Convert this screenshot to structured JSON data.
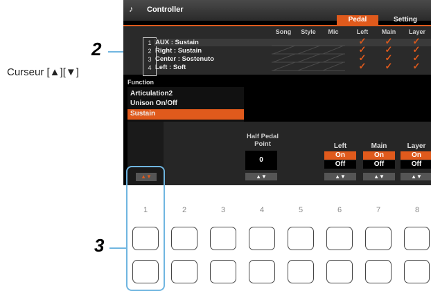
{
  "screen": {
    "title": "Controller",
    "title_icon": "♪",
    "tabs": [
      {
        "label": "Pedal",
        "active": true
      },
      {
        "label": "Setting",
        "active": false
      }
    ],
    "columns": [
      "Song",
      "Style",
      "Mic",
      "Left",
      "Main",
      "Layer"
    ],
    "rows": [
      {
        "num": "1",
        "label": "AUX : Sustain"
      },
      {
        "num": "2",
        "label": "Right : Sustain"
      },
      {
        "num": "3",
        "label": "Center : Sostenuto"
      },
      {
        "num": "4",
        "label": "Left : Soft"
      }
    ],
    "check_glyph": "✓",
    "function_label": "Function",
    "function_items": [
      "Articulation2",
      "Unison On/Off",
      "Sustain"
    ],
    "half_pedal_label_1": "Half Pedal",
    "half_pedal_label_2": "Point",
    "half_pedal_value": "0",
    "switches": [
      {
        "label": "Left",
        "on": "On",
        "off": "Off"
      },
      {
        "label": "Main",
        "on": "On",
        "off": "Off"
      },
      {
        "label": "Layer",
        "on": "On",
        "off": "Off"
      }
    ],
    "arrows": "▲▼",
    "accent_color": "#e05a1c"
  },
  "annotations": {
    "callout_2": "2",
    "callout_3": "3",
    "cursor_label": "Curseur [▲][▼]"
  },
  "buttons": {
    "numbers": [
      "1",
      "2",
      "3",
      "4",
      "5",
      "6",
      "7",
      "8"
    ]
  }
}
